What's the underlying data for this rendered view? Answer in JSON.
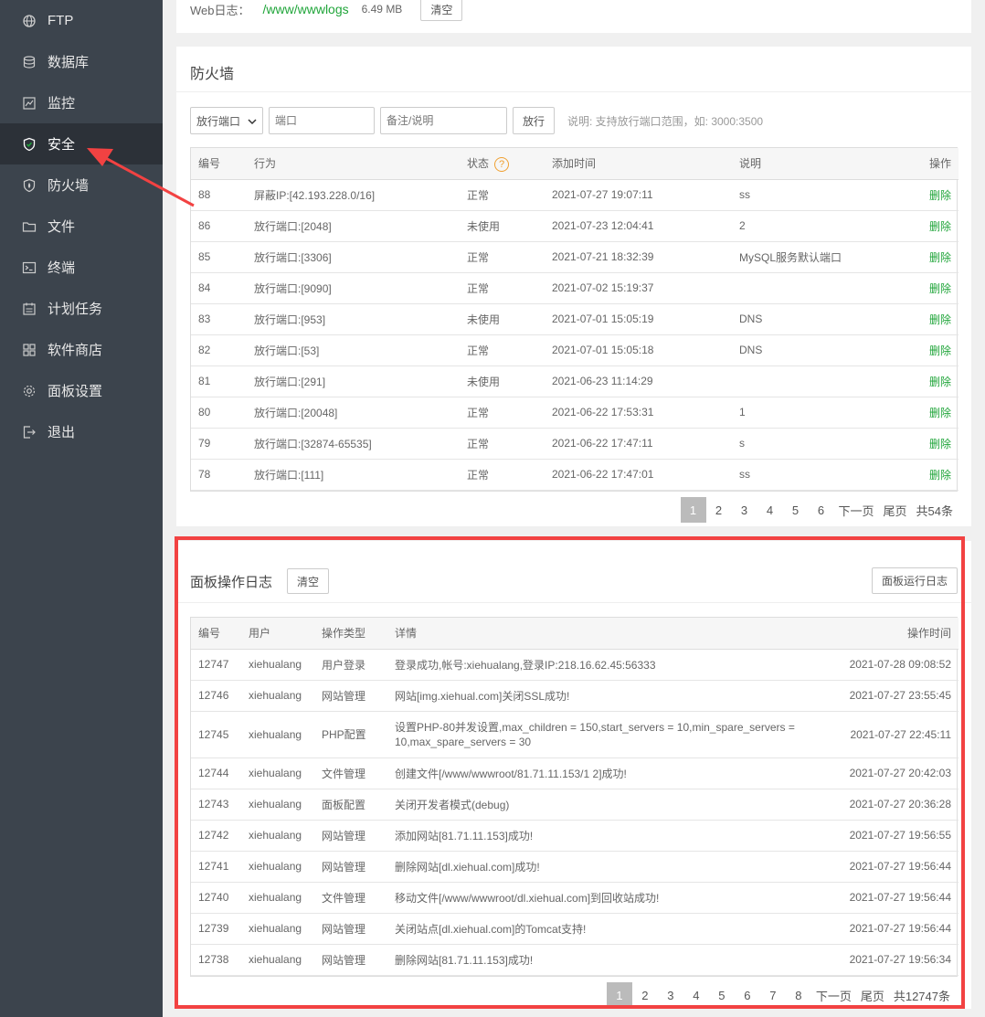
{
  "sidebar": {
    "items": [
      {
        "label": "FTP",
        "icon": "globe-icon",
        "active": false
      },
      {
        "label": "数据库",
        "icon": "database-icon",
        "active": false
      },
      {
        "label": "监控",
        "icon": "monitor-icon",
        "active": false
      },
      {
        "label": "安全",
        "icon": "shield-icon",
        "active": true
      },
      {
        "label": "防火墙",
        "icon": "firewall-icon",
        "active": false
      },
      {
        "label": "文件",
        "icon": "folder-icon",
        "active": false
      },
      {
        "label": "终端",
        "icon": "terminal-icon",
        "active": false
      },
      {
        "label": "计划任务",
        "icon": "calendar-icon",
        "active": false
      },
      {
        "label": "软件商店",
        "icon": "apps-icon",
        "active": false
      },
      {
        "label": "面板设置",
        "icon": "gear-icon",
        "active": false
      },
      {
        "label": "退出",
        "icon": "logout-icon",
        "active": false
      }
    ]
  },
  "weblog": {
    "label": "Web日志：",
    "path": "/www/wwwlogs",
    "size": "6.49 MB",
    "clear_label": "清空"
  },
  "firewall": {
    "title": "防火墙",
    "select_value": "放行端口",
    "port_placeholder": "端口",
    "note_placeholder": "备注/说明",
    "submit_label": "放行",
    "hint": "说明: 支持放行端口范围，如: 3000:3500",
    "columns": [
      "编号",
      "行为",
      "状态",
      "添加时间",
      "说明",
      "操作"
    ],
    "help_glyph": "?",
    "rows": [
      [
        "88",
        "屏蔽IP:[42.193.228.0/16]",
        "正常",
        "2021-07-27 19:07:11",
        "ss",
        "删除"
      ],
      [
        "86",
        "放行端口:[2048]",
        "未使用",
        "2021-07-23 12:04:41",
        "2",
        "删除"
      ],
      [
        "85",
        "放行端口:[3306]",
        "正常",
        "2021-07-21 18:32:39",
        "MySQL服务默认端口",
        "删除"
      ],
      [
        "84",
        "放行端口:[9090]",
        "正常",
        "2021-07-02 15:19:37",
        "",
        "删除"
      ],
      [
        "83",
        "放行端口:[953]",
        "未使用",
        "2021-07-01 15:05:19",
        "DNS",
        "删除"
      ],
      [
        "82",
        "放行端口:[53]",
        "正常",
        "2021-07-01 15:05:18",
        "DNS",
        "删除"
      ],
      [
        "81",
        "放行端口:[291]",
        "未使用",
        "2021-06-23 11:14:29",
        "",
        "删除"
      ],
      [
        "80",
        "放行端口:[20048]",
        "正常",
        "2021-06-22 17:53:31",
        "1",
        "删除"
      ],
      [
        "79",
        "放行端口:[32874-65535]",
        "正常",
        "2021-06-22 17:47:11",
        "s",
        "删除"
      ],
      [
        "78",
        "放行端口:[111]",
        "正常",
        "2021-06-22 17:47:01",
        "ss",
        "删除"
      ]
    ],
    "pager": {
      "pages": [
        "1",
        "2",
        "3",
        "4",
        "5",
        "6"
      ],
      "current": "1",
      "next": "下一页",
      "last": "尾页",
      "total": "共54条"
    }
  },
  "panel_log": {
    "title": "面板操作日志",
    "clear_label": "清空",
    "run_log_label": "面板运行日志",
    "columns": [
      "编号",
      "用户",
      "操作类型",
      "详情",
      "操作时间"
    ],
    "rows": [
      [
        "12747",
        "xiehualang",
        "用户登录",
        "登录成功,帐号:xiehualang,登录IP:218.16.62.45:56333",
        "2021-07-28 09:08:52"
      ],
      [
        "12746",
        "xiehualang",
        "网站管理",
        "网站[img.xiehual.com]关闭SSL成功!",
        "2021-07-27 23:55:45"
      ],
      [
        "12745",
        "xiehualang",
        "PHP配置",
        "设置PHP-80并发设置,max_children = 150,start_servers = 10,min_spare_servers = 10,max_spare_servers = 30",
        "2021-07-27 22:45:11"
      ],
      [
        "12744",
        "xiehualang",
        "文件管理",
        "创建文件[/www/wwwroot/81.71.11.153/1 2]成功!",
        "2021-07-27 20:42:03"
      ],
      [
        "12743",
        "xiehualang",
        "面板配置",
        "关闭开发者模式(debug)",
        "2021-07-27 20:36:28"
      ],
      [
        "12742",
        "xiehualang",
        "网站管理",
        "添加网站[81.71.11.153]成功!",
        "2021-07-27 19:56:55"
      ],
      [
        "12741",
        "xiehualang",
        "网站管理",
        "删除网站[dl.xiehual.com]成功!",
        "2021-07-27 19:56:44"
      ],
      [
        "12740",
        "xiehualang",
        "文件管理",
        "移动文件[/www/wwwroot/dl.xiehual.com]到回收站成功!",
        "2021-07-27 19:56:44"
      ],
      [
        "12739",
        "xiehualang",
        "网站管理",
        "关闭站点[dl.xiehual.com]的Tomcat支持!",
        "2021-07-27 19:56:44"
      ],
      [
        "12738",
        "xiehualang",
        "网站管理",
        "删除网站[81.71.11.153]成功!",
        "2021-07-27 19:56:34"
      ]
    ],
    "pager": {
      "pages": [
        "1",
        "2",
        "3",
        "4",
        "5",
        "6",
        "7",
        "8"
      ],
      "current": "1",
      "next": "下一页",
      "last": "尾页",
      "total": "共12747条"
    }
  },
  "colors": {
    "accent_green": "#20a53a",
    "sidebar_bg": "#3c444d",
    "highlight_red": "#f24242",
    "help_orange": "#f0a030"
  }
}
